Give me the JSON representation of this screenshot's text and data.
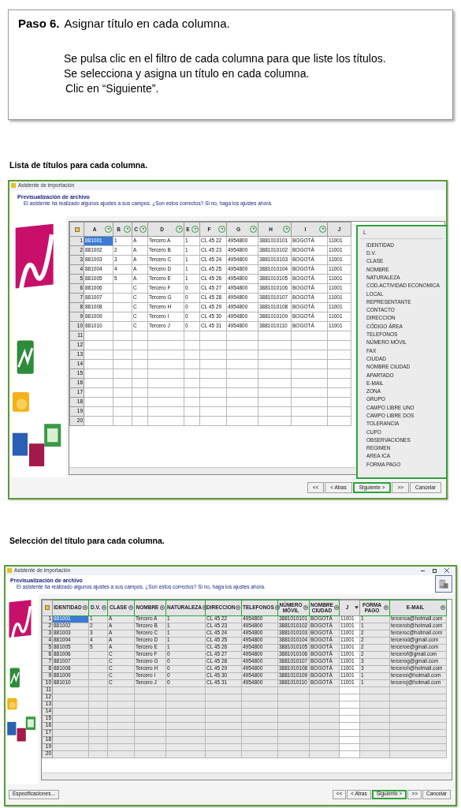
{
  "step": {
    "number": "Paso 6.",
    "title": "Asignar título en cada columna.",
    "lines": [
      "Se pulsa clic en el filtro de cada columna para que liste los títulos.",
      "Se selecciona y asigna un título en cada columna.",
      "Clic en “Siguiente”."
    ]
  },
  "screens": [
    {
      "caption": "Lista de títulos para cada columna.",
      "window": {
        "title": "Asistente de importación",
        "heading": "Previsualización de archivo",
        "subtitle": "El asistente ha realizado algunos ajustes a sus campos. ¿Son estos correctos? Si no, haga los ajustes ahora.",
        "window_controls": false
      },
      "table": {
        "shaded": false,
        "boxed_headers": false,
        "columns": [
          {
            "label": "A",
            "kind": "filter"
          },
          {
            "label": "B",
            "kind": "filter"
          },
          {
            "label": "C",
            "kind": "filter"
          },
          {
            "label": "D",
            "kind": "filter"
          },
          {
            "label": "E",
            "kind": "filter"
          },
          {
            "label": "F",
            "kind": "filter"
          },
          {
            "label": "G",
            "kind": "filter"
          },
          {
            "label": "H",
            "kind": "filter"
          },
          {
            "label": "I",
            "kind": "filter"
          },
          {
            "label": "J",
            "kind": "plain"
          }
        ],
        "row_numbers": [
          "1",
          "2",
          "3",
          "4",
          "5",
          "6",
          "7",
          "8",
          "9",
          "10",
          "11",
          "12",
          "13",
          "14",
          "15",
          "16",
          "17",
          "18",
          "19",
          "20"
        ],
        "rows": [
          {
            "selected": true,
            "cells": [
              "881001",
              "1",
              "A",
              "Tercero A",
              "1",
              "CL 45 22",
              "4954800",
              "3881010101",
              "BOGOTÁ",
              "11001"
            ]
          },
          {
            "selected": false,
            "cells": [
              "881002",
              "2",
              "A",
              "Tercero B",
              "1",
              "CL 45 23",
              "4954800",
              "3881010102",
              "BOGOTÁ",
              "11001"
            ]
          },
          {
            "selected": false,
            "cells": [
              "881003",
              "3",
              "A",
              "Tercero C",
              "1",
              "CL 45 24",
              "4954800",
              "3881010103",
              "BOGOTÁ",
              "11001"
            ]
          },
          {
            "selected": false,
            "cells": [
              "881004",
              "4",
              "A",
              "Tercero D",
              "1",
              "CL 45 25",
              "4954800",
              "3881010104",
              "BOGOTÁ",
              "11001"
            ]
          },
          {
            "selected": false,
            "cells": [
              "881005",
              "5",
              "A",
              "Tercero E",
              "1",
              "CL 45 26",
              "4954800",
              "3881010105",
              "BOGOTÁ",
              "11001"
            ]
          },
          {
            "selected": false,
            "cells": [
              "881006",
              "",
              "C",
              "Tercero F",
              "0",
              "CL 45 27",
              "4954800",
              "3881010106",
              "BOGOTÁ",
              "11001"
            ]
          },
          {
            "selected": false,
            "cells": [
              "881007",
              "",
              "C",
              "Tercero G",
              "0",
              "CL 45 28",
              "4954800",
              "3881010107",
              "BOGOTÁ",
              "11001"
            ]
          },
          {
            "selected": false,
            "cells": [
              "881008",
              "",
              "C",
              "Tercero H",
              "0",
              "CL 45 29",
              "4954800",
              "3881010108",
              "BOGOTÁ",
              "11001"
            ]
          },
          {
            "selected": false,
            "cells": [
              "881009",
              "",
              "C",
              "Tercero I",
              "0",
              "CL 45 30",
              "4954800",
              "3881010109",
              "BOGOTÁ",
              "11001"
            ]
          },
          {
            "selected": false,
            "cells": [
              "881010",
              "",
              "C",
              "Tercero J",
              "0",
              "CL 45 31",
              "4954800",
              "3881010110",
              "BOGOTÁ",
              "11001"
            ]
          }
        ]
      },
      "dropdown": {
        "current": "L",
        "items": [
          "IDENTIDAD",
          "D.V.",
          "CLASE",
          "NOMBRE",
          "NATURALEZA",
          "COD.ACTIVIDAD ECONOMICA",
          "LOCAL",
          "REPRESENTANTE",
          "CONTACTO",
          "DIRECCION",
          "CÓDIGO ÁREA",
          "TELEFONOS",
          "NÚMERO MÓVIL",
          "FAX",
          "CIUDAD",
          "NOMBRE CIUDAD",
          "APARTADO",
          "E-MAIL",
          "ZONA",
          "GRUPO",
          "CAMPO LIBRE UNO",
          "CAMPO LIBRE DOS",
          "TOLERANCIA",
          "CUPO",
          "OBSERVACIONES",
          "REGIMEN",
          "AREA ICA",
          "FORMA PAGO"
        ]
      },
      "buttons": [
        {
          "label": "<<",
          "highlighted": false
        },
        {
          "label": "< Atras",
          "highlighted": false
        },
        {
          "label": "Siguiente >",
          "highlighted": true
        },
        {
          "label": ">>",
          "highlighted": false
        },
        {
          "label": "Cancelar",
          "highlighted": false
        }
      ]
    },
    {
      "caption": "Selección del título para cada columna.",
      "window": {
        "title": "Asistente de importación",
        "heading": "Previsualización de archivo",
        "subtitle": "El asistente ha realizado algunos ajustes a sus campos. ¿Son estos correctos? Si no, haga los ajustes ahora.",
        "window_controls": true
      },
      "table": {
        "shaded": true,
        "boxed_headers": true,
        "columns": [
          {
            "label": "IDENTIDAD",
            "kind": "filter"
          },
          {
            "label": "D.V.",
            "kind": "filter"
          },
          {
            "label": "CLASE",
            "kind": "filter"
          },
          {
            "label": "NOMBRE",
            "kind": "filter"
          },
          {
            "label": "NATURALEZA",
            "kind": "filter"
          },
          {
            "label": "DIRECCION",
            "kind": "filter"
          },
          {
            "label": "TELEFONOS",
            "kind": "filter"
          },
          {
            "label": "NÚMERO MÓVIL",
            "kind": "filter"
          },
          {
            "label": "NOMBRE CIUDAD",
            "kind": "filter"
          },
          {
            "label": "J",
            "kind": "arrow"
          },
          {
            "label": "FORMA PAGO",
            "kind": "filter"
          },
          {
            "label": "E-MAIL",
            "kind": "filter"
          }
        ],
        "row_numbers": [
          "1",
          "2",
          "3",
          "4",
          "5",
          "6",
          "7",
          "8",
          "9",
          "10",
          "11",
          "12",
          "13",
          "14",
          "15",
          "16",
          "17",
          "18",
          "19",
          "20"
        ],
        "rows": [
          {
            "selected": true,
            "cells": [
              "881001",
              "1",
              "A",
              "Tercero A",
              "1",
              "CL 45 22",
              "4954800",
              "3881010101",
              "BOGOTÁ",
              "11001",
              "1",
              "terceroa@hotmail.com"
            ]
          },
          {
            "selected": false,
            "cells": [
              "881002",
              "2",
              "A",
              "Tercero B",
              "1",
              "CL 45 23",
              "4954800",
              "3881010102",
              "BOGOTÁ",
              "11001",
              "1",
              "tercerob@hotmail.com"
            ]
          },
          {
            "selected": false,
            "cells": [
              "881003",
              "3",
              "A",
              "Tercero C",
              "1",
              "CL 45 24",
              "4954800",
              "3881010103",
              "BOGOTÁ",
              "11001",
              "2",
              "terceroc@hotmail.com"
            ]
          },
          {
            "selected": false,
            "cells": [
              "881004",
              "4",
              "A",
              "Tercero D",
              "1",
              "CL 45 25",
              "4954800",
              "3881010104",
              "BOGOTÁ",
              "11001",
              "2",
              "tercerod@gmail.com"
            ]
          },
          {
            "selected": false,
            "cells": [
              "881005",
              "5",
              "A",
              "Tercero E",
              "1",
              "CL 45 26",
              "4954800",
              "3881010105",
              "BOGOTÁ",
              "11001",
              "2",
              "terceroe@gmail.com"
            ]
          },
          {
            "selected": false,
            "cells": [
              "881006",
              "",
              "C",
              "Tercero F",
              "0",
              "CL 45 27",
              "4954800",
              "3881010106",
              "BOGOTÁ",
              "11001",
              "2",
              "tercerof@gmail.com"
            ]
          },
          {
            "selected": false,
            "cells": [
              "881007",
              "",
              "C",
              "Tercero G",
              "0",
              "CL 45 28",
              "4954800",
              "3881010107",
              "BOGOTÁ",
              "11001",
              "3",
              "tercerog@gmail.com"
            ]
          },
          {
            "selected": false,
            "cells": [
              "881008",
              "",
              "C",
              "Tercero H",
              "0",
              "CL 45 29",
              "4954800",
              "3881010108",
              "BOGOTÁ",
              "11001",
              "3",
              "terceroh@hotmail.com"
            ]
          },
          {
            "selected": false,
            "cells": [
              "881009",
              "",
              "C",
              "Tercero I",
              "0",
              "CL 45 30",
              "4954800",
              "3881010109",
              "BOGOTÁ",
              "11001",
              "1",
              "terceroi@hotmail.com"
            ]
          },
          {
            "selected": false,
            "cells": [
              "881010",
              "",
              "C",
              "Tercero J",
              "0",
              "CL 45 31",
              "4954800",
              "3881010110",
              "BOGOTÁ",
              "11001",
              "1",
              "terceroj@hotmail.com"
            ]
          }
        ]
      },
      "left_buttons": [
        {
          "label": "Especificaciones...",
          "highlighted": false
        }
      ],
      "buttons": [
        {
          "label": "<<",
          "highlighted": false
        },
        {
          "label": "< Atras",
          "highlighted": false
        },
        {
          "label": "Siguiente >",
          "highlighted": true
        },
        {
          "label": ">>",
          "highlighted": false
        },
        {
          "label": "Cancelar",
          "highlighted": false
        }
      ]
    }
  ]
}
